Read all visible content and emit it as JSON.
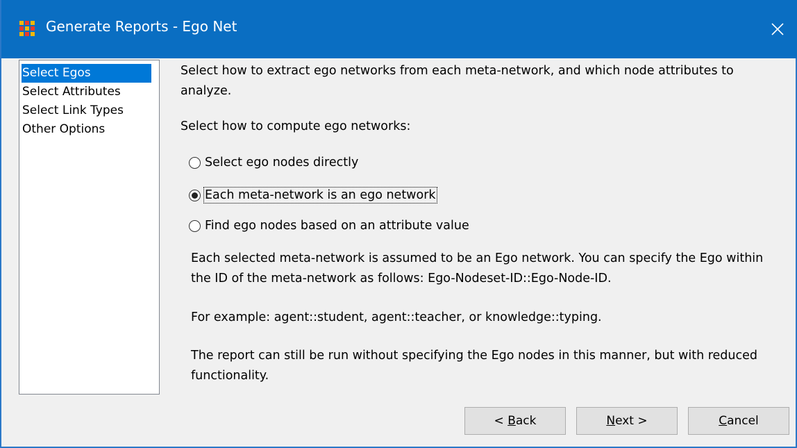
{
  "window": {
    "title": "Generate Reports - Ego Net",
    "close_glyph": "✕",
    "accent_color": "#0a6ec2"
  },
  "nav": {
    "items": [
      {
        "label": "Select Egos",
        "selected": true
      },
      {
        "label": "Select Attributes",
        "selected": false
      },
      {
        "label": "Select Link Types",
        "selected": false
      },
      {
        "label": "Other Options",
        "selected": false
      }
    ]
  },
  "main": {
    "intro": "Select how to extract ego networks from each meta-network, and which node attributes to analyze.",
    "compute_label": "Select how to compute ego networks:",
    "options": [
      {
        "label": "Select ego nodes directly",
        "checked": false
      },
      {
        "label": "Each meta-network is an ego network",
        "checked": true
      },
      {
        "label": "Find ego nodes based on an attribute value",
        "checked": false
      }
    ],
    "description": [
      "Each selected meta-network is assumed to be an Ego network. You can specify the Ego within the ID of the meta-network as follows: Ego-Nodeset-ID::Ego-Node-ID.",
      "For example: agent::student, agent::teacher, or knowledge::typing.",
      "The report can still be run without specifying the Ego nodes in this manner, but with reduced functionality."
    ]
  },
  "buttons": {
    "back": {
      "prefix": "< ",
      "mnemonic": "B",
      "rest": "ack"
    },
    "next": {
      "mnemonic": "N",
      "rest": "ext >"
    },
    "cancel": {
      "mnemonic": "C",
      "rest": "ancel"
    }
  }
}
